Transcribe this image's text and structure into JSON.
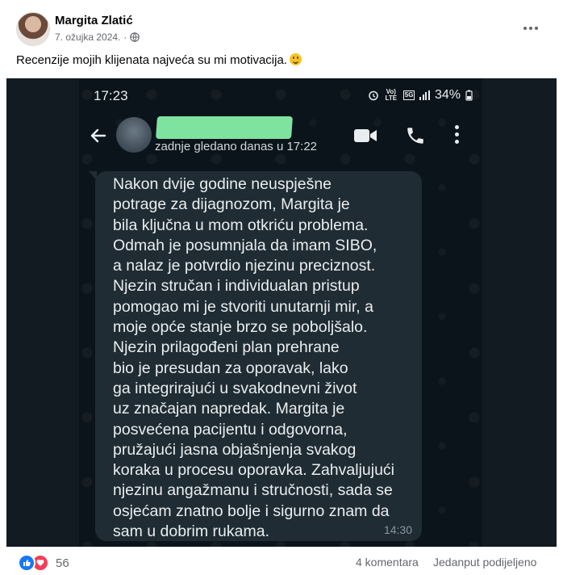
{
  "post": {
    "author": "Margita Zlatić",
    "date": "7. ožujka 2024.",
    "date_separator": "·",
    "text": "Recenzije mojih klijenata najveća su mi motivacija.",
    "emoji_icon": "smiling-face-emoji"
  },
  "screenshot": {
    "status_time": "17:23",
    "network_label": "Vo) LTE",
    "network_type": "5G",
    "battery": "34%",
    "last_seen": "zadnje gledano danas u 17:22",
    "message": "Nakon dvije godine neuspješne\npotrage za dijagnozom, Margita je\nbila ključna u mom otkriću problema.\nOdmah je posumnjala da imam SIBO,\na nalaz je potvrdio njezinu preciznost.\nNjezin stručan i individualan pristup\npomogao mi je stvoriti unutarnji mir, a\nmoje opće stanje brzo se poboljšalo.\nNjezin prilagođeni plan prehrane\nbio je presudan za oporavak, lako\nga integrirajući u svakodnevni život\nuz značajan napredak. Margita je\nposvećena pacijentu i odgovorna,\npružajući jasna objašnjenja svakog\nkoraka u procesu oporavka. Zahvaljujući\nnjezinu angažmanu i stručnosti, sada se\nosjećam znatno bolje i sigurno znam da\nsam u dobrim rukama.",
    "message_time": "14:30",
    "colors": {
      "background": "#0b141a",
      "bubble": "#202c33",
      "redaction": "#7fe3a0"
    }
  },
  "footer": {
    "reaction_count": "56",
    "comments": "4 komentara",
    "shares": "Jedanput podijeljeno",
    "reaction_icons": [
      "like-icon",
      "love-icon"
    ]
  }
}
